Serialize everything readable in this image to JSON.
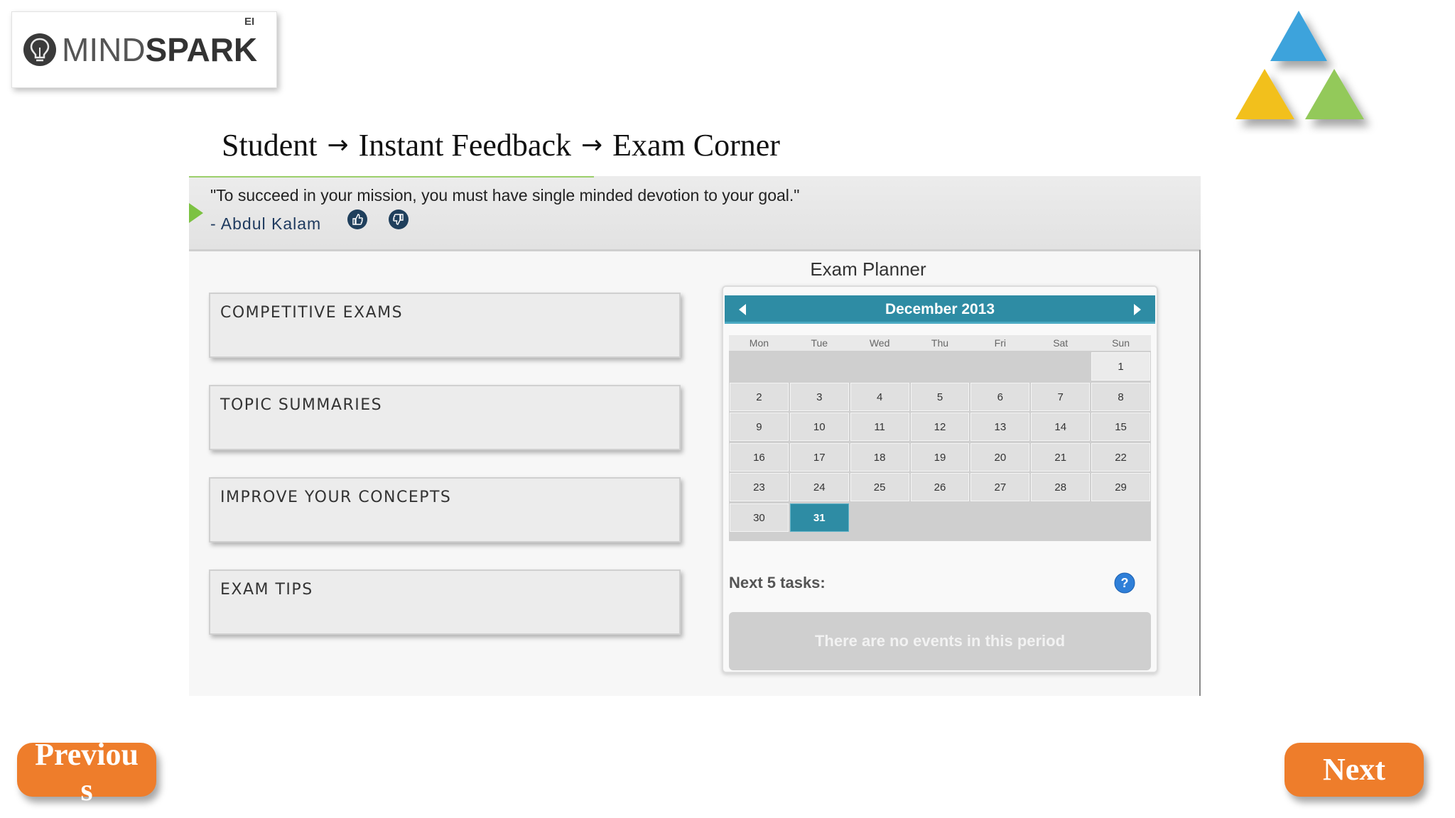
{
  "logo": {
    "brand_light": "MIND",
    "brand_bold": "SPARK",
    "superscript": "EI",
    "icon": "lightbulb-icon"
  },
  "decoration": {
    "triangle_colors": [
      "#3ea3dc",
      "#f2c01a",
      "#93c95a"
    ]
  },
  "breadcrumb": {
    "items": [
      "Student",
      "Instant Feedback",
      "Exam Corner"
    ],
    "separator": "→"
  },
  "quote": {
    "text": "\"To succeed in your mission, you must have single minded devotion to your goal.\"",
    "author": "- Abdul Kalam",
    "like_icon": "thumbs-up-icon",
    "dislike_icon": "thumbs-down-icon"
  },
  "categories": [
    {
      "label": "COMPETITIVE EXAMS"
    },
    {
      "label": "TOPIC SUMMARIES"
    },
    {
      "label": "IMPROVE YOUR CONCEPTS"
    },
    {
      "label": "EXAM TIPS"
    }
  ],
  "planner": {
    "title": "Exam Planner",
    "month": "December 2013",
    "weekdays": [
      "Mon",
      "Tue",
      "Wed",
      "Thu",
      "Fri",
      "Sat",
      "Sun"
    ],
    "first_weekday_index": 6,
    "days_in_month": 31,
    "selected_day": 31,
    "tasks_label": "Next 5 tasks:",
    "empty_message": "There are no events in this period",
    "accent_color": "#2e8ca4"
  },
  "navigation": {
    "previous_label": "Previous",
    "next_label": "Next",
    "button_color": "#ee7d2b"
  }
}
